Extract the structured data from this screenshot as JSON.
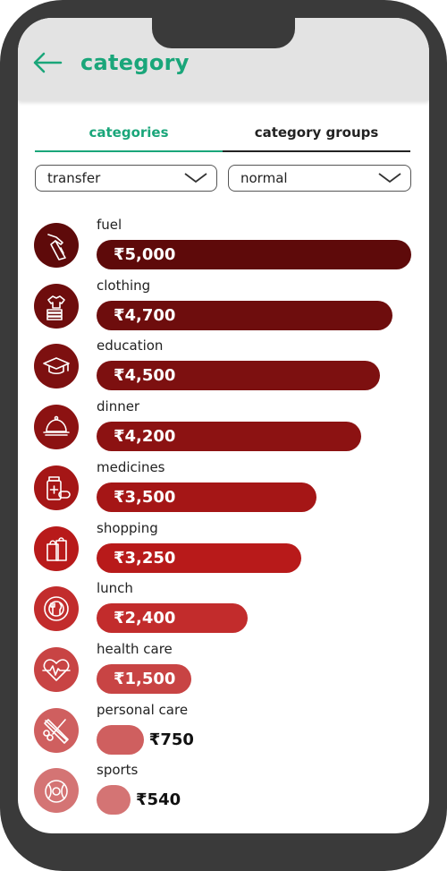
{
  "header": {
    "title": "category"
  },
  "tabs": [
    {
      "label": "categories",
      "active": true
    },
    {
      "label": "category groups",
      "active": false
    }
  ],
  "filters": {
    "type": {
      "value": "transfer"
    },
    "mode": {
      "value": "normal"
    }
  },
  "currency": "₹",
  "max_amount": 5000,
  "categories": [
    {
      "name": "fuel",
      "amount": "₹5,000",
      "value": 5000,
      "color": "#5e0a0a",
      "icon": "fuel-icon"
    },
    {
      "name": "clothing",
      "amount": "₹4,700",
      "value": 4700,
      "color": "#6e0d0d",
      "icon": "clothing-icon"
    },
    {
      "name": "education",
      "amount": "₹4,500",
      "value": 4500,
      "color": "#7d1010",
      "icon": "graduation-cap-icon"
    },
    {
      "name": "dinner",
      "amount": "₹4,200",
      "value": 4200,
      "color": "#8c1212",
      "icon": "cloche-icon"
    },
    {
      "name": "medicines",
      "amount": "₹3,500",
      "value": 3500,
      "color": "#a51616",
      "icon": "medicine-icon"
    },
    {
      "name": "shopping",
      "amount": "₹3,250",
      "value": 3250,
      "color": "#b81a1a",
      "icon": "shopping-bag-icon"
    },
    {
      "name": "lunch",
      "amount": "₹2,400",
      "value": 2400,
      "color": "#c22c2c",
      "icon": "plate-cutlery-icon"
    },
    {
      "name": "health care",
      "amount": "₹1,500",
      "value": 1500,
      "color": "#c84444",
      "icon": "heartbeat-icon"
    },
    {
      "name": "personal care",
      "amount": "₹750",
      "value": 750,
      "color": "#cf5f5f",
      "icon": "scissors-razor-icon"
    },
    {
      "name": "sports",
      "amount": "₹540",
      "value": 540,
      "color": "#d47474",
      "icon": "ball-icon"
    }
  ]
}
